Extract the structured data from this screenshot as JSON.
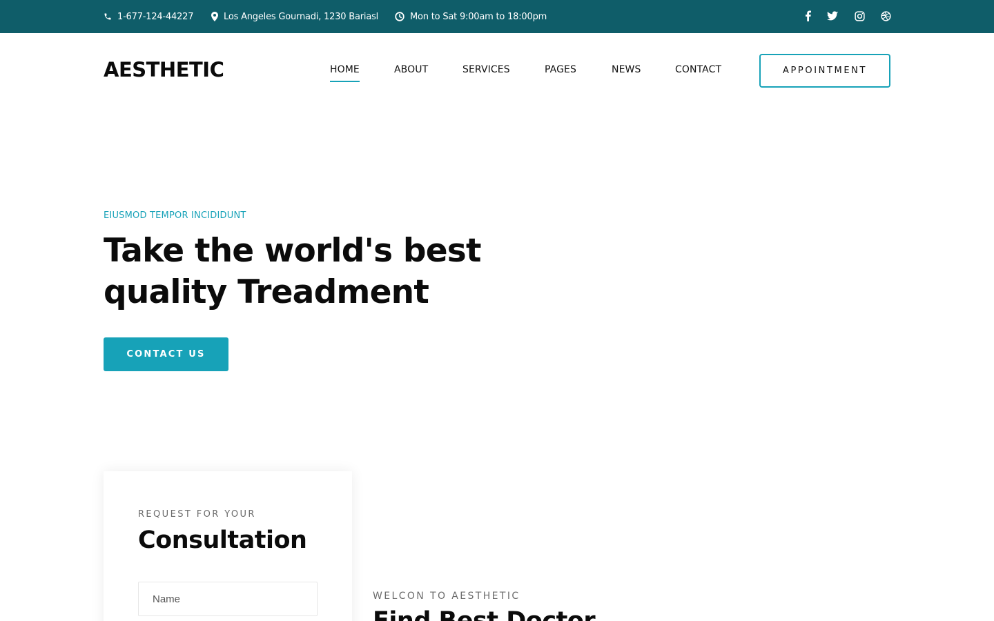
{
  "topbar": {
    "phone": "1-677-124-44227",
    "address": "Los Angeles Gournadi, 1230 Bariasl",
    "hours": "Mon to Sat 9:00am to 18:00pm",
    "social_icons": [
      "facebook-icon",
      "twitter-icon",
      "instagram-icon",
      "dribbble-icon"
    ]
  },
  "header": {
    "logo": "AESTHETIC",
    "nav": [
      {
        "label": "HOME",
        "active": true
      },
      {
        "label": "ABOUT",
        "active": false
      },
      {
        "label": "SERVICES",
        "active": false
      },
      {
        "label": "PAGES",
        "active": false
      },
      {
        "label": "NEWS",
        "active": false
      },
      {
        "label": "CONTACT",
        "active": false
      }
    ],
    "appointment_label": "APPOINTMENT"
  },
  "hero": {
    "eyebrow": "EIUSMOD TEMPOR INCIDIDUNT",
    "headline": "Take the world's best quality Treadment",
    "cta_label": "CONTACT US"
  },
  "consultation": {
    "eyebrow": "REQUEST FOR YOUR",
    "title": "Consultation",
    "name_placeholder": "Name"
  },
  "about": {
    "eyebrow": "WELCON TO AESTHETIC",
    "title": "Find Best Doctor"
  },
  "colors": {
    "topbar_bg": "#0f5d69",
    "accent": "#17a2b8",
    "text_dark": "#0b0b0b"
  }
}
